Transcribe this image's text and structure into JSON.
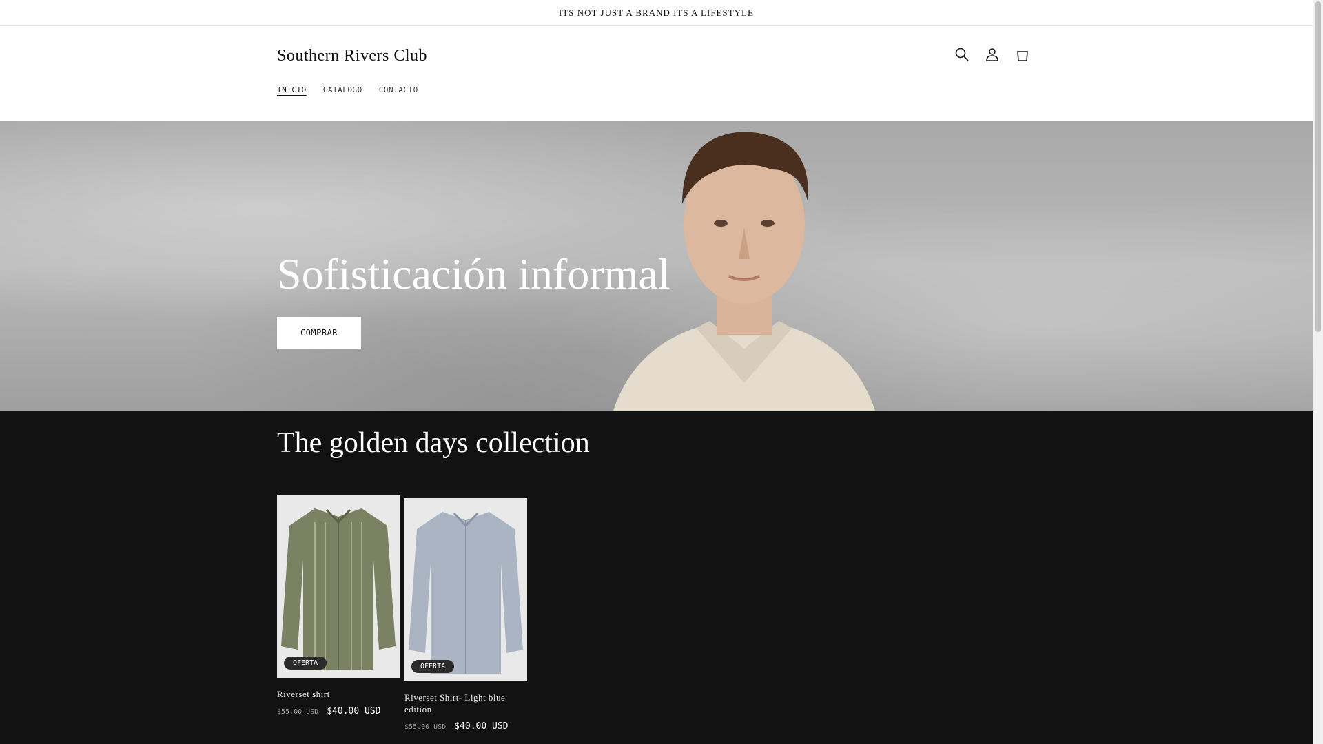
{
  "announcement": {
    "text": "ITS NOT JUST A BRAND ITS A LIFESTYLE"
  },
  "header": {
    "brand": "Southern Rivers Club",
    "icons": [
      "search-icon",
      "account-icon",
      "cart-icon"
    ],
    "nav": [
      {
        "label": "INICIO",
        "active": true
      },
      {
        "label": "CATÁLOGO",
        "active": false
      },
      {
        "label": "CONTACTO",
        "active": false
      }
    ]
  },
  "hero": {
    "title": "Sofisticación informal",
    "button": "COMPRAR"
  },
  "collection": {
    "title": "The golden days collection",
    "products": [
      {
        "title": "Riverset shirt",
        "badge": "OFERTA",
        "price_old": "$55.00 USD",
        "price_new": "$40.00 USD",
        "shirt_color": "#7b8163"
      },
      {
        "title": "Riverset Shirt- Light blue edition",
        "badge": "OFERTA",
        "price_old": "$55.00 USD",
        "price_new": "$40.00 USD",
        "shirt_color": "#aab4c3"
      }
    ]
  },
  "colors": {
    "background_dark": "#121212",
    "header_bg": "#ffffff",
    "text_dark": "#121212"
  }
}
